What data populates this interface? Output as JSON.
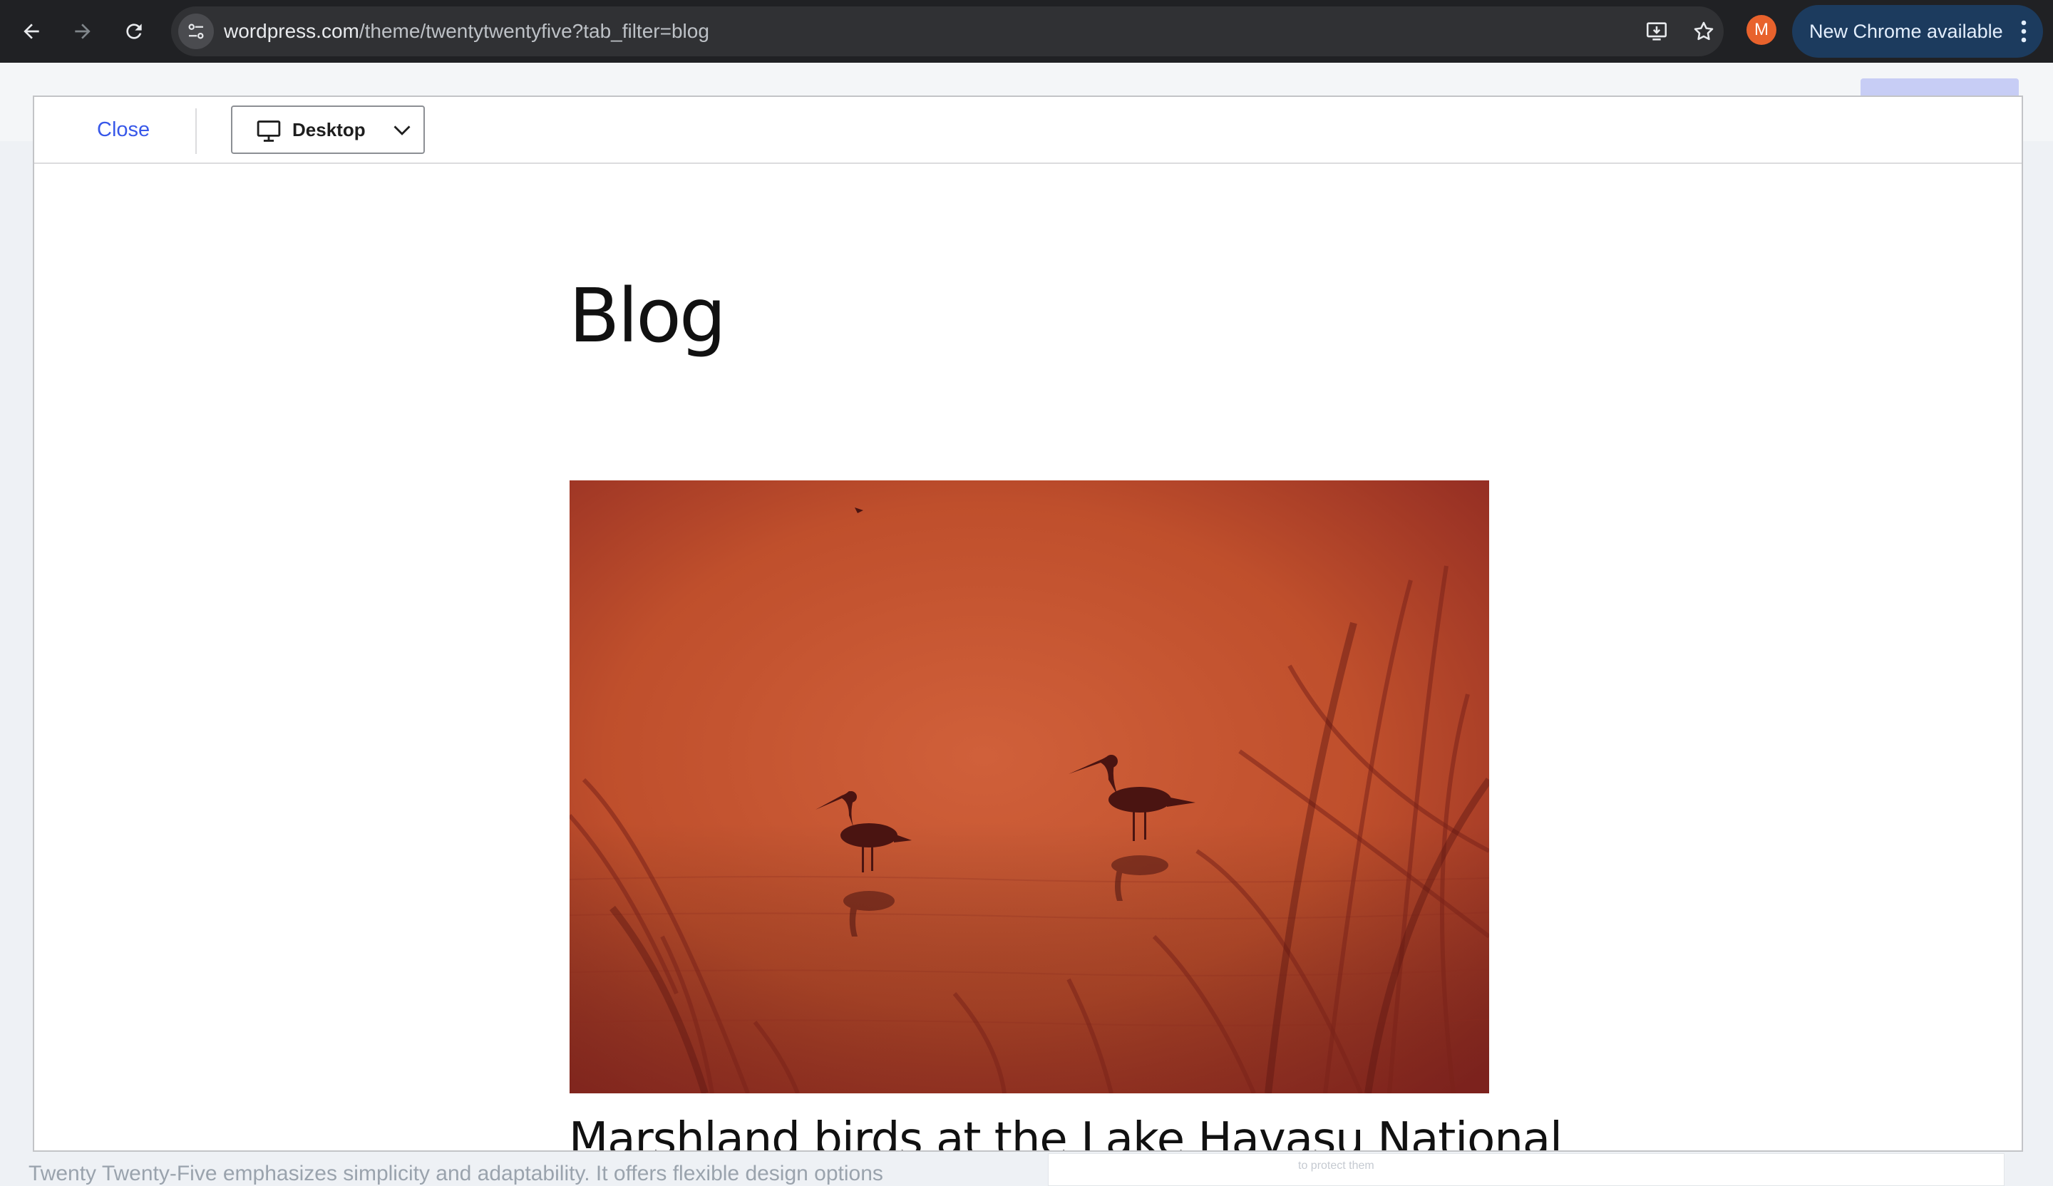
{
  "browser": {
    "url_host": "wordpress.com",
    "url_path": "/theme/twentytwentyfive?tab_filter=blog",
    "profile_initial": "M",
    "update_label": "New Chrome available",
    "icons": [
      "back-arrow-icon",
      "forward-arrow-icon",
      "reload-icon",
      "site-info-icon",
      "install-app-icon",
      "bookmark-star-icon",
      "more-vertical-icon"
    ]
  },
  "background_page": {
    "description_text": "Twenty Twenty-Five emphasizes simplicity and adaptability. It offers flexible design options",
    "card_text": "to protect them"
  },
  "preview_modal": {
    "close_label": "Close",
    "device_label": "Desktop",
    "device_icon": "desktop-icon",
    "page_title": "Blog",
    "post_title": "Marshland birds at the Lake Havasu National",
    "colors": {
      "accent": "#3858e9",
      "image_tone": "#c4532e"
    }
  }
}
